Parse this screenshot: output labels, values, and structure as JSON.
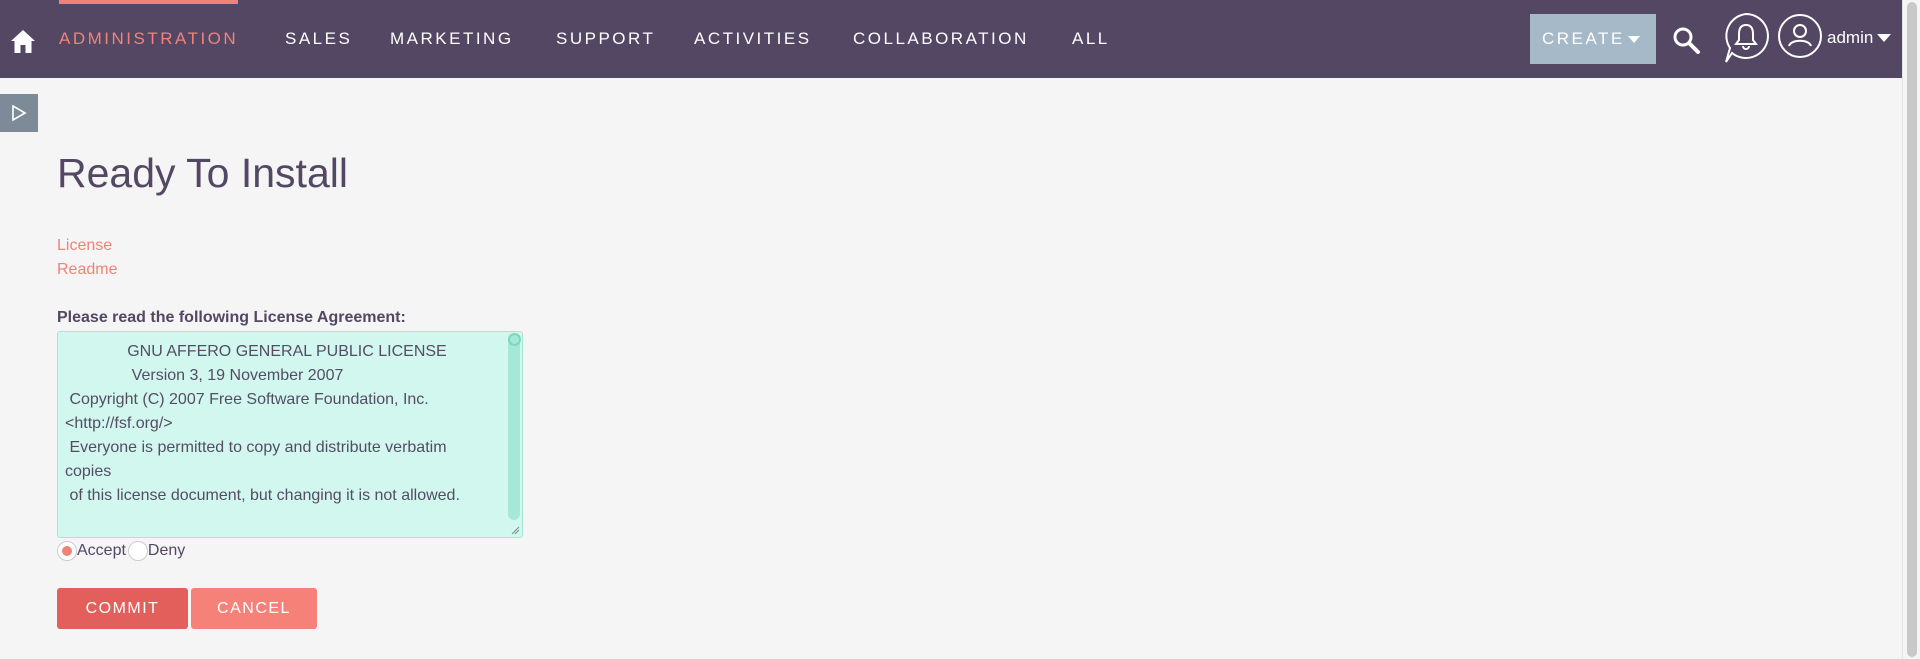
{
  "nav": {
    "items": [
      {
        "label": "ADMINISTRATION",
        "active": true
      },
      {
        "label": "SALES",
        "active": false
      },
      {
        "label": "MARKETING",
        "active": false
      },
      {
        "label": "SUPPORT",
        "active": false
      },
      {
        "label": "ACTIVITIES",
        "active": false
      },
      {
        "label": "COLLABORATION",
        "active": false
      },
      {
        "label": "ALL",
        "active": false
      }
    ],
    "create_label": "CREATE",
    "user_name": "admin"
  },
  "page": {
    "title": "Ready To Install",
    "links": {
      "license": "License",
      "readme": "Readme"
    },
    "agreement_label": "Please read the following License Agreement:",
    "license_lines": [
      "              GNU AFFERO GENERAL PUBLIC LICENSE",
      "               Version 3, 19 November 2007",
      "",
      " Copyright (C) 2007 Free Software Foundation, Inc.",
      "<http://fsf.org/>",
      " Everyone is permitted to copy and distribute verbatim",
      "copies",
      " of this license document, but changing it is not allowed."
    ],
    "radio": {
      "accept": "Accept",
      "deny": "Deny",
      "selected": "accept"
    },
    "buttons": {
      "commit": "COMMIT",
      "cancel": "CANCEL"
    }
  },
  "colors": {
    "nav_bg": "#534764",
    "accent": "#f08377",
    "create_bg": "#a5b9c8",
    "license_bg": "#d2f7ee",
    "commit_bg": "#e35f5c",
    "cancel_bg": "#f58178"
  },
  "icons": {
    "home": "home-icon",
    "search": "search-icon",
    "bell": "bell-icon",
    "user": "user-icon",
    "sidebar": "triangle-right-icon"
  }
}
